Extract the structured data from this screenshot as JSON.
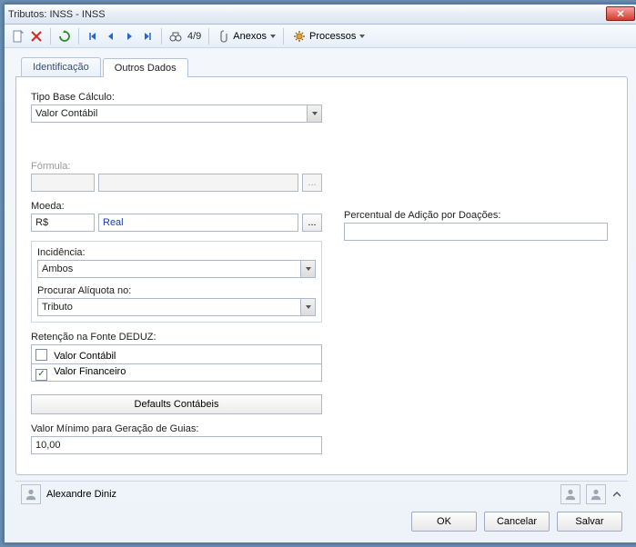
{
  "window": {
    "title": "Tributos: INSS - INSS"
  },
  "toolbar": {
    "counter": "4/9",
    "anexos": "Anexos",
    "processos": "Processos"
  },
  "tabs": {
    "identificacao": "Identificação",
    "outros": "Outros Dados"
  },
  "form": {
    "tipo_base_label": "Tipo Base Cálculo:",
    "tipo_base_value": "Valor Contábil",
    "formula_label": "Fórmula:",
    "moeda_label": "Moeda:",
    "moeda_code": "R$",
    "moeda_name": "Real",
    "incidencia_label": "Incidência:",
    "incidencia_value": "Ambos",
    "procurar_label": "Procurar Alíquota no:",
    "procurar_value": "Tributo",
    "retencao_label": "Retenção na Fonte DEDUZ:",
    "chk_contabil": "Valor Contábil",
    "chk_financeiro": "Valor Financeiro",
    "defaults_btn": "Defaults Contábeis",
    "valor_min_label": "Valor Mínimo para Geração de Guias:",
    "valor_min_value": "10,00",
    "percentual_label": "Percentual de Adição por Doações:"
  },
  "status": {
    "user": "Alexandre Diniz"
  },
  "buttons": {
    "ok": "OK",
    "cancel": "Cancelar",
    "save": "Salvar"
  }
}
